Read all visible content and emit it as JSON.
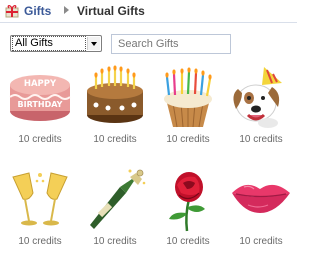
{
  "breadcrumb": {
    "root": "Gifts",
    "current": "Virtual Gifts"
  },
  "filter": {
    "selected": "All Gifts"
  },
  "search": {
    "placeholder": "Search Gifts"
  },
  "gifts": [
    {
      "name": "happy-birthday-cake",
      "price": "10 credits"
    },
    {
      "name": "chocolate-cake",
      "price": "10 credits"
    },
    {
      "name": "cupcake",
      "price": "10 credits"
    },
    {
      "name": "party-dog",
      "price": "10 credits"
    },
    {
      "name": "champagne-glasses",
      "price": "10 credits"
    },
    {
      "name": "champagne-bottle",
      "price": "10 credits"
    },
    {
      "name": "red-rose",
      "price": "10 credits"
    },
    {
      "name": "lips-kiss",
      "price": "10 credits"
    }
  ],
  "cake_text": "HAPPY BIRTHDAY",
  "colors": {
    "link": "#3b5998",
    "muted": "#6a6a6a"
  },
  "icons": [
    "gift-icon",
    "chevron-right-icon",
    "dropdown-arrow-icon"
  ]
}
